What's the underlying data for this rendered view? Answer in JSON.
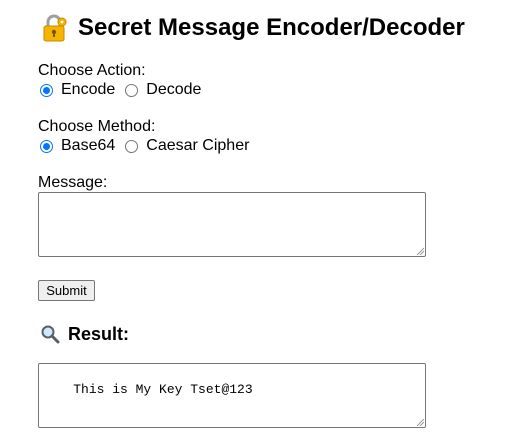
{
  "header": {
    "title": "Secret Message Encoder/Decoder",
    "icon": "locked-with-key-icon"
  },
  "action": {
    "label": "Choose Action:",
    "options": [
      {
        "label": "Encode",
        "checked": true
      },
      {
        "label": "Decode",
        "checked": false
      }
    ]
  },
  "method": {
    "label": "Choose Method:",
    "options": [
      {
        "label": "Base64",
        "checked": true
      },
      {
        "label": "Caesar Cipher",
        "checked": false
      }
    ]
  },
  "message": {
    "label": "Message:",
    "value": ""
  },
  "submit": {
    "label": "Submit"
  },
  "result": {
    "title": "Result:",
    "icon": "magnifying-glass-icon",
    "value": "This is My Key Tset@123"
  },
  "colors": {
    "radio_accent": "#0075ff",
    "border": "#767676",
    "button_bg": "#efefef"
  }
}
